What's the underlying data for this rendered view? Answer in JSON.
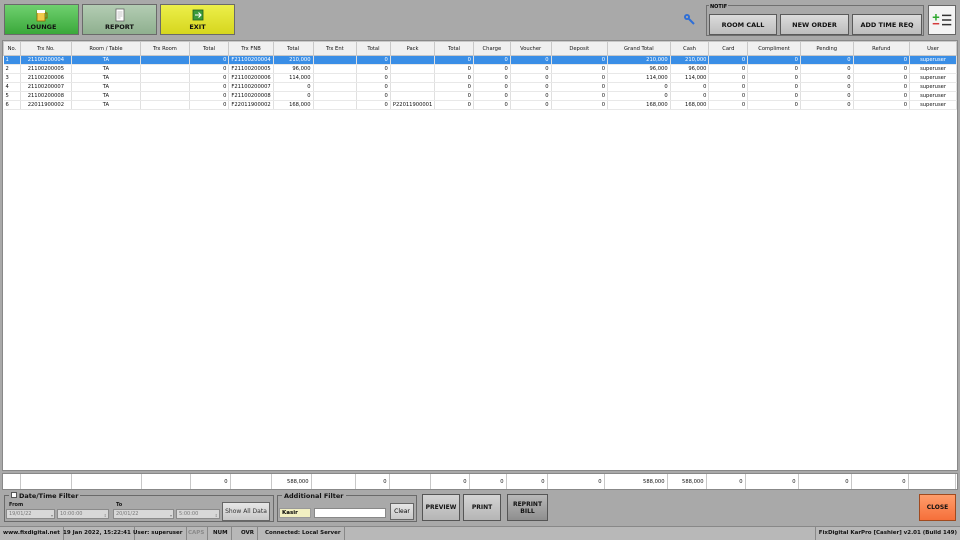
{
  "toolbar": {
    "lounge": "LOUNGE",
    "report": "REPORT",
    "exit": "EXIT"
  },
  "notif": {
    "legend": "NOTIF",
    "room_call": "ROOM CALL",
    "new_order": "NEW ORDER",
    "add_time_req": "ADD TIME REQ"
  },
  "columns": [
    {
      "label": "No.",
      "w": 17,
      "a": "l"
    },
    {
      "label": "Trx No.",
      "w": 51,
      "a": "c"
    },
    {
      "label": "Room / Table",
      "w": 70,
      "a": "c"
    },
    {
      "label": "Trx Room",
      "w": 49,
      "a": "l"
    },
    {
      "label": "Total",
      "w": 40,
      "a": "r"
    },
    {
      "label": "Trx FNB",
      "w": 41,
      "a": "l"
    },
    {
      "label": "Total",
      "w": 40,
      "a": "r"
    },
    {
      "label": "Trx Ent",
      "w": 44,
      "a": "l"
    },
    {
      "label": "Total",
      "w": 34,
      "a": "r"
    },
    {
      "label": "Pack",
      "w": 41,
      "a": "l"
    },
    {
      "label": "Total",
      "w": 39,
      "a": "r"
    },
    {
      "label": "Charge",
      "w": 37,
      "a": "r"
    },
    {
      "label": "Voucher",
      "w": 41,
      "a": "r"
    },
    {
      "label": "Deposit",
      "w": 57,
      "a": "r"
    },
    {
      "label": "Grand Total",
      "w": 63,
      "a": "r"
    },
    {
      "label": "Cash",
      "w": 39,
      "a": "r"
    },
    {
      "label": "Card",
      "w": 39,
      "a": "r"
    },
    {
      "label": "Compliment",
      "w": 53,
      "a": "r"
    },
    {
      "label": "Pending",
      "w": 53,
      "a": "r"
    },
    {
      "label": "Refund",
      "w": 57,
      "a": "r"
    },
    {
      "label": "User",
      "w": 47,
      "a": "c"
    }
  ],
  "rows": [
    [
      "1",
      "21100200004",
      "TA",
      "",
      "0",
      "F21100200004",
      "210,000",
      "",
      "0",
      "",
      "0",
      "0",
      "0",
      "0",
      "210,000",
      "210,000",
      "0",
      "0",
      "0",
      "0",
      "superuser"
    ],
    [
      "2",
      "21100200005",
      "TA",
      "",
      "0",
      "F21100200005",
      "96,000",
      "",
      "0",
      "",
      "0",
      "0",
      "0",
      "0",
      "96,000",
      "96,000",
      "0",
      "0",
      "0",
      "0",
      "superuser"
    ],
    [
      "3",
      "21100200006",
      "TA",
      "",
      "0",
      "F21100200006",
      "114,000",
      "",
      "0",
      "",
      "0",
      "0",
      "0",
      "0",
      "114,000",
      "114,000",
      "0",
      "0",
      "0",
      "0",
      "superuser"
    ],
    [
      "4",
      "21100200007",
      "TA",
      "",
      "0",
      "F21100200007",
      "0",
      "",
      "0",
      "",
      "0",
      "0",
      "0",
      "0",
      "0",
      "0",
      "0",
      "0",
      "0",
      "0",
      "superuser"
    ],
    [
      "5",
      "21100200008",
      "TA",
      "",
      "0",
      "F21100200008",
      "0",
      "",
      "0",
      "",
      "0",
      "0",
      "0",
      "0",
      "0",
      "0",
      "0",
      "0",
      "0",
      "0",
      "superuser"
    ],
    [
      "6",
      "22011900002",
      "TA",
      "",
      "0",
      "F22011900002",
      "168,000",
      "",
      "0",
      "P22011900001",
      "0",
      "0",
      "0",
      "0",
      "168,000",
      "168,000",
      "0",
      "0",
      "0",
      "0",
      "superuser"
    ]
  ],
  "selected_row": 0,
  "totals": [
    "",
    "",
    "",
    "",
    "0",
    "",
    "588,000",
    "",
    "0",
    "",
    "0",
    "0",
    "0",
    "0",
    "588,000",
    "588,000",
    "0",
    "0",
    "0",
    "0",
    ""
  ],
  "date_filter": {
    "legend": "Date/Time Filter",
    "from_label": "From",
    "to_label": "To",
    "from_date": "19/01/22",
    "from_time": "10:00:00",
    "to_date": "20/01/22",
    "to_time": "5:00:00",
    "show_all": "Show All Data"
  },
  "additional_filter": {
    "legend": "Additional Filter",
    "kasir": "Kasir",
    "kasir_value": "",
    "clear": "Clear"
  },
  "actions": {
    "preview": "PREVIEW",
    "print": "PRINT",
    "reprint_bill": "REPRINT BILL",
    "close": "CLOSE"
  },
  "status": {
    "website": "www.fixdigital.net",
    "datetime": "19 Jan 2022, 15:22:41",
    "user": "User: superuser",
    "caps": "CAPS",
    "num": "NUM",
    "ovr": "OVR",
    "connection": "Connected: Local Server",
    "app": "FixDigital KarPro [Cashier] v2.01 (Build 149)"
  }
}
